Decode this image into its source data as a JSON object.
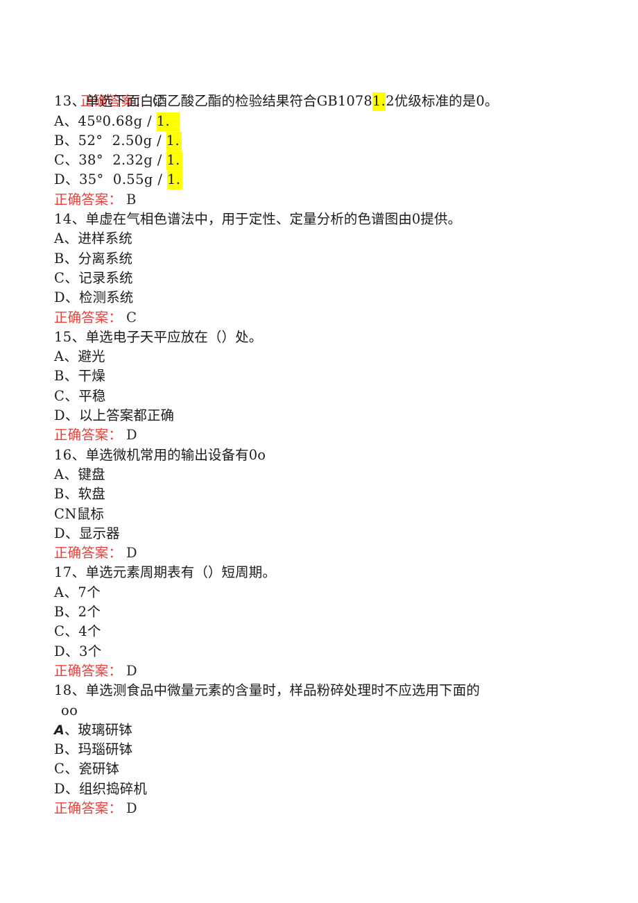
{
  "document": {
    "type": "exam-question-bank",
    "language": "zh-CN",
    "answer_label": "正确答案：",
    "colors": {
      "answer_label": "#e8413c",
      "highlight": "#ffff00",
      "text": "#1c1c1c",
      "background": "#ffffff"
    },
    "leading_answer": {
      "label": "正确答案：",
      "letter": "C"
    },
    "questions": [
      {
        "number": "13、",
        "type_tag": "单选",
        "stem_before_highlight": "下面白酒乙酸乙酯的检验结果符合GB1078",
        "stem_highlight": "1.",
        "stem_after_highlight": "2优级标准的是0。",
        "options": [
          {
            "letter": "A、",
            "text": "45º0.68g / ",
            "highlight": "1."
          },
          {
            "letter": "B、",
            "text": "52°  2.50g / ",
            "highlight": "1."
          },
          {
            "letter": "C、",
            "text": "38°  2.32g / ",
            "highlight": "1."
          },
          {
            "letter": "D、",
            "text": "35°  0.55g / ",
            "highlight": "1."
          }
        ],
        "answer": {
          "label": "正确答案：",
          "letter": "B"
        }
      },
      {
        "number": "14、",
        "type_tag": "单虚",
        "stem": "在气相色谱法中，用于定性、定量分析的色谱图由0提供。",
        "options": [
          {
            "letter": "A、",
            "text": "进样系统"
          },
          {
            "letter": "B、",
            "text": "分离系统"
          },
          {
            "letter": "C、",
            "text": "记录系统"
          },
          {
            "letter": "D、",
            "text": "检测系统"
          }
        ],
        "answer": {
          "label": "正确答案：",
          "letter": "C"
        }
      },
      {
        "number": "15、",
        "type_tag": "单选",
        "stem": "电子天平应放在（）处。",
        "options": [
          {
            "letter": "A、",
            "text": "避光"
          },
          {
            "letter": "B、",
            "text": "干燥"
          },
          {
            "letter": "C、",
            "text": "平稳"
          },
          {
            "letter": "D、",
            "text": "以上答案都正确"
          }
        ],
        "answer": {
          "label": "正确答案：",
          "letter": "D"
        }
      },
      {
        "number": "16、",
        "type_tag": "单选",
        "stem": "微机常用的输出设备有0o",
        "options": [
          {
            "letter": "A、",
            "text": "键盘"
          },
          {
            "letter": "B、",
            "text": "软盘"
          },
          {
            "letter": "CN",
            "text": "鼠标"
          },
          {
            "letter": "D、",
            "text": "显示器"
          }
        ],
        "answer": {
          "label": "正确答案：",
          "letter": "D"
        }
      },
      {
        "number": "17、",
        "type_tag": "单选",
        "stem": "元素周期表有（）短周期。",
        "options": [
          {
            "letter": "A、",
            "text": "7个"
          },
          {
            "letter": "B、",
            "text": "2个"
          },
          {
            "letter": "C、",
            "text": "4个"
          },
          {
            "letter": "D、",
            "text": "3个"
          }
        ],
        "answer": {
          "label": "正确答案：",
          "letter": "D"
        }
      },
      {
        "number": "18、",
        "type_tag": "单选",
        "stem": "测食品中微量元素的含量时，样品粉碎处理时不应选用下面的",
        "stem_wrap": "oo",
        "options": [
          {
            "letter": "A",
            "letter_suffix": "、",
            "text": "玻璃研钵",
            "style": "italic-bold"
          },
          {
            "letter": "B、",
            "text": "玛瑙研钵"
          },
          {
            "letter": "C、",
            "text": "瓷研钵"
          },
          {
            "letter": "D、",
            "text": "组织捣碎机"
          }
        ],
        "answer": {
          "label": "正确答案：",
          "letter": "D"
        }
      }
    ]
  }
}
